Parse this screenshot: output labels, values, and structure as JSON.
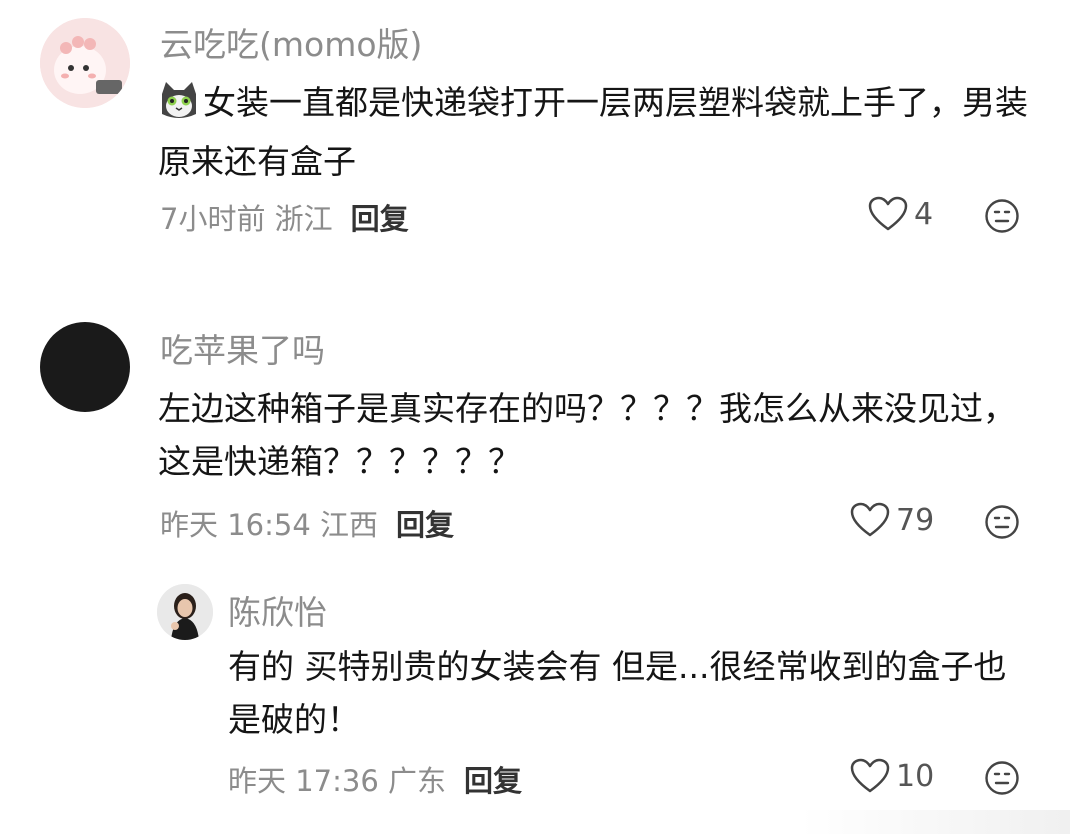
{
  "comments": [
    {
      "username": "云吃吃(momo版)",
      "text": "女装一直都是快递袋打开一层两层塑料袋就上手了，男装原来还有盒子",
      "time_location": "7小时前 浙江",
      "reply_label": "回复",
      "likes": "4",
      "icons": {
        "inline": "cat-emoji-icon",
        "like": "heart-outline-icon",
        "react": "meh-face-icon"
      }
    },
    {
      "username": "吃苹果了吗",
      "text": "左边这种箱子是真实存在的吗？？？？我怎么从来没见过，这是快递箱？？？？？？",
      "time_location": "昨天 16:54 江西",
      "reply_label": "回复",
      "likes": "79",
      "icons": {
        "like": "heart-outline-icon",
        "react": "meh-face-icon"
      }
    }
  ],
  "reply": {
    "username": "陈欣怡",
    "text": "有的 买特别贵的女装会有 但是...很经常收到的盒子也是破的！",
    "time_location": "昨天 17:36 广东",
    "reply_label": "回复",
    "likes": "10",
    "icons": {
      "like": "heart-outline-icon",
      "react": "meh-face-icon"
    }
  },
  "colors": {
    "text": "#151515",
    "meta": "#8c8c8c",
    "avatar_dark": "#1a1a1a",
    "avatar_pink": "#f6d9d9"
  }
}
